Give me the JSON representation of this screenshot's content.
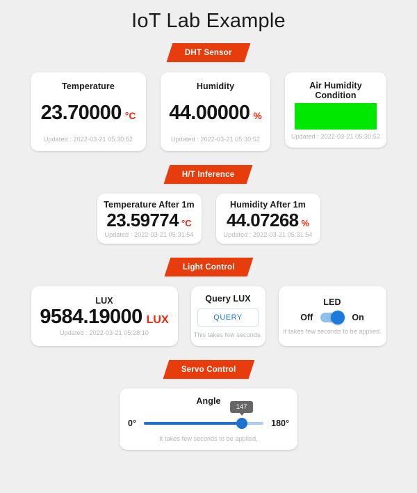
{
  "page": {
    "title": "IoT Lab Example",
    "background_color": "#efefef",
    "accent_color": "#e73c0c",
    "unit_color": "#f3250a",
    "link_color": "#1e78d7"
  },
  "sections": {
    "dht": {
      "badge": "DHT Sensor"
    },
    "inference": {
      "badge": "H/T Inference"
    },
    "light": {
      "badge": "Light Control"
    },
    "servo": {
      "badge": "Servo Control"
    }
  },
  "dht": {
    "temperature": {
      "title": "Temperature",
      "value": "23.70000",
      "unit": "°C",
      "updated": "Updated : 2022-03-21 05:30:52"
    },
    "humidity": {
      "title": "Humidity",
      "value": "44.00000",
      "unit": "%",
      "updated": "Updated : 2022-03-21 05:30:52"
    },
    "condition": {
      "title": "Air Humidity Condition",
      "status_color": "#00e800",
      "updated": "Updated : 2022-03-21 05:30:52"
    }
  },
  "inference": {
    "temperature": {
      "title": "Temperature After 1m",
      "value": "23.59774",
      "unit": "°C",
      "updated": "Updated : 2022-03-21 05:31:54"
    },
    "humidity": {
      "title": "Humidity After 1m",
      "value": "44.07268",
      "unit": "%",
      "updated": "Updated : 2022-03-21 05:31:54"
    }
  },
  "light": {
    "lux": {
      "title": "LUX",
      "value": "9584.19000",
      "unit": "LUX",
      "updated": "Updated : 2022-03-21 05:28:10"
    },
    "query": {
      "title": "Query LUX",
      "button_label": "QUERY",
      "hint": "This takes few seconds."
    },
    "led": {
      "title": "LED",
      "off_label": "Off",
      "on_label": "On",
      "state": "on",
      "hint": "It takes few seconds to be applied."
    }
  },
  "servo": {
    "angle": {
      "title": "Angle",
      "value": "147",
      "min_label": "0°",
      "max_label": "180°",
      "min": 0,
      "max": 180,
      "percent": "81.7",
      "hint": "It takes few seconds to be applied."
    }
  }
}
